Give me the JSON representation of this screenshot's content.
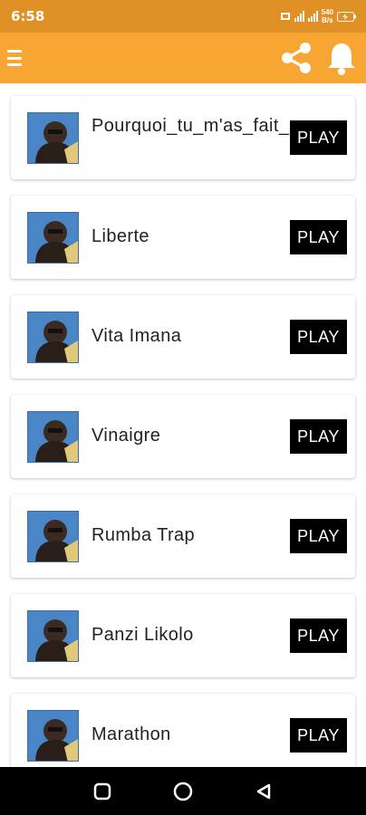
{
  "status_bar": {
    "time": "6:58",
    "net_speed_value": "540",
    "net_speed_unit": "B/s"
  },
  "app_bar": {
    "menu_icon": "hamburger-icon",
    "share_icon": "share-icon",
    "notification_icon": "bell-icon",
    "color": "#f7a533"
  },
  "songs": [
    {
      "title": "Pourquoi_tu_m'as_fait_",
      "play_label": "PLAY"
    },
    {
      "title": "Liberte",
      "play_label": "PLAY"
    },
    {
      "title": "Vita Imana",
      "play_label": "PLAY"
    },
    {
      "title": "Vinaigre",
      "play_label": "PLAY"
    },
    {
      "title": "Rumba Trap",
      "play_label": "PLAY"
    },
    {
      "title": "Panzi Likolo",
      "play_label": "PLAY"
    },
    {
      "title": "Marathon",
      "play_label": "PLAY"
    }
  ],
  "nav_bar": {
    "recents_icon": "square-icon",
    "home_icon": "circle-icon",
    "back_icon": "triangle-back-icon"
  }
}
